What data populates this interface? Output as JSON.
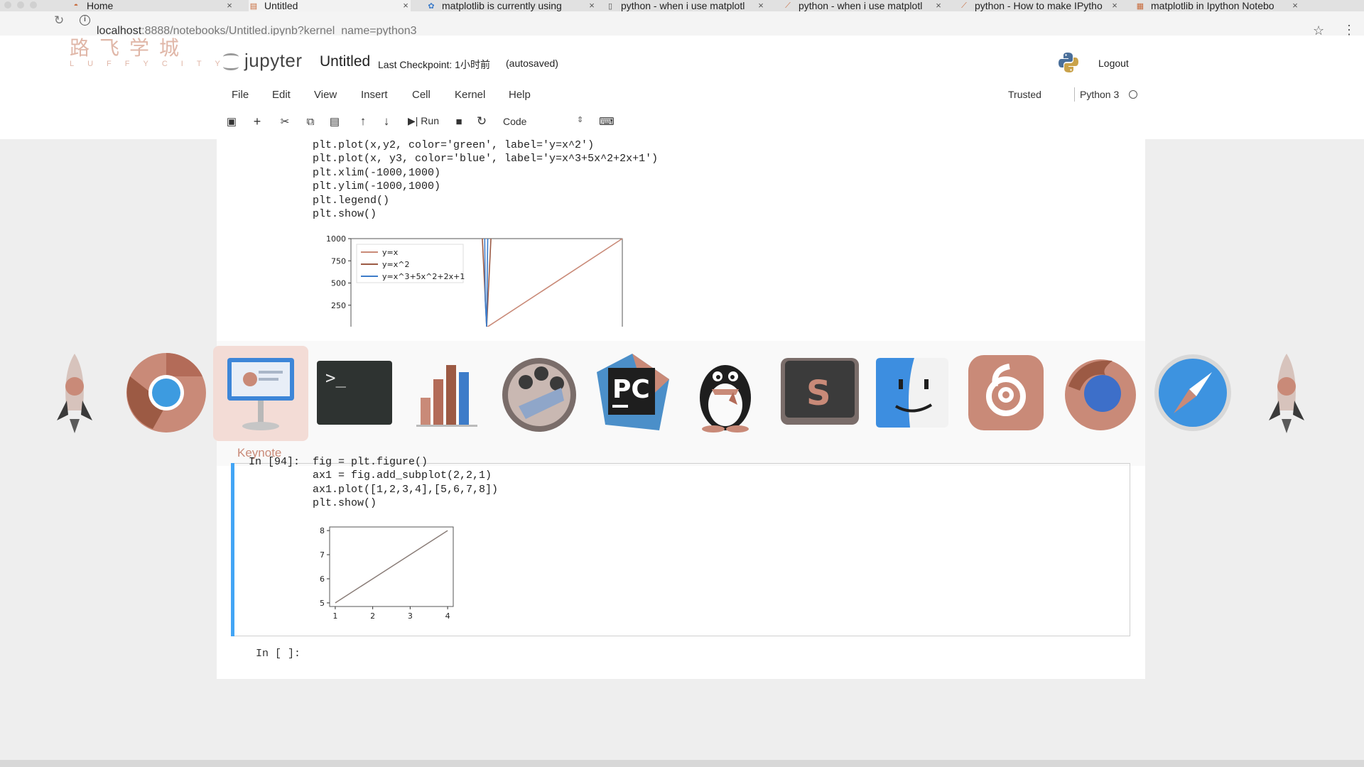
{
  "browser": {
    "tabs": [
      {
        "label": "Home",
        "active": false
      },
      {
        "label": "Untitled",
        "active": true
      },
      {
        "label": "matplotlib is currently using",
        "active": false
      },
      {
        "label": "python - when i use matplotl",
        "active": false
      },
      {
        "label": "python - when i use matplotl",
        "active": false
      },
      {
        "label": "python - How to make IPytho",
        "active": false
      },
      {
        "label": "matplotlib in Ipython Notebo",
        "active": false
      }
    ],
    "url_host": "localhost",
    "url_rest": ":8888/notebooks/Untitled.ipynb?kernel_name=python3"
  },
  "watermark": {
    "cn": "路飞学城",
    "en": "LUFFYCITY"
  },
  "header": {
    "logo_text": "jupyter",
    "title": "Untitled",
    "checkpoint": "Last Checkpoint: 1小时前",
    "autosaved": "(autosaved)",
    "logout": "Logout"
  },
  "menu": {
    "items": [
      "File",
      "Edit",
      "View",
      "Insert",
      "Cell",
      "Kernel",
      "Help"
    ],
    "trusted": "Trusted",
    "kernel": "Python 3"
  },
  "toolbar": {
    "run_label": "Run",
    "cell_type": "Code"
  },
  "cells": {
    "cell1_lines": [
      "plt.plot(x,y2, color='green', label='y=x^2')",
      "plt.plot(x, y3, color='blue', label='y=x^3+5x^2+2x+1')",
      "plt.xlim(-1000,1000)",
      "plt.ylim(-1000,1000)",
      "plt.legend()",
      "plt.show()"
    ],
    "cell2_lines": [
      "In [94]:  fig = plt.figure()",
      "ax1 = fig.add_subplot(2,2,1)",
      "ax1.plot([1,2,3,4],[5,6,7,8])",
      "plt.show()"
    ],
    "empty_prompt": "In [ ]:"
  },
  "chart_data": [
    {
      "type": "line",
      "ylim": [
        -1000,
        1000
      ],
      "xlim": [
        -1000,
        1000
      ],
      "yticks": [
        "1000",
        "750",
        "500",
        "250"
      ],
      "series": [
        {
          "name": "y=x",
          "color": "#c98a78",
          "x": [
            0,
            1000
          ],
          "y": [
            0,
            1000
          ]
        },
        {
          "name": "y=x^2",
          "color": "#9c5a44",
          "x": [
            -31.6,
            0,
            31.6
          ],
          "y": [
            1000,
            0,
            1000
          ]
        },
        {
          "name": "y=x^3+5x^2+2x+1",
          "color": "#3d7cc9",
          "x": [
            -14,
            -10,
            0,
            8
          ],
          "y": [
            1000,
            300,
            1,
            1000
          ]
        }
      ],
      "legend_placement": "upper-left"
    },
    {
      "type": "line",
      "x": [
        1,
        2,
        3,
        4
      ],
      "y": [
        5,
        6,
        7,
        8
      ],
      "xlim": [
        0.85,
        4.15
      ],
      "ylim": [
        4.85,
        8.15
      ],
      "xticks": [
        "1",
        "2",
        "3",
        "4"
      ],
      "yticks": [
        "8",
        "7",
        "6",
        "5"
      ],
      "color": "#8a7d78"
    }
  ],
  "dock": {
    "apps": [
      "rocket-python",
      "chrome",
      "keynote",
      "terminal",
      "instruments-chart",
      "app-people",
      "pycharm",
      "qq",
      "sublime-text",
      "finder",
      "netease-music",
      "firefox",
      "safari",
      "rocket-python"
    ],
    "hovered_label": "Keynote"
  }
}
